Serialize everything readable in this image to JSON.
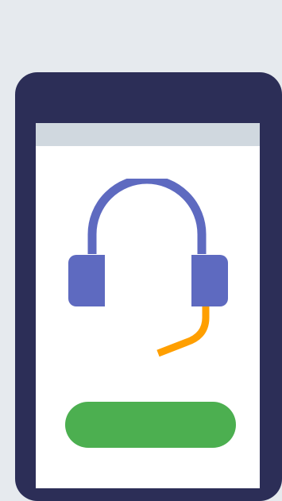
{
  "colors": {
    "background": "#e6eaee",
    "device_frame": "#2c2e57",
    "screen": "#ffffff",
    "status_bar": "#d0d8df",
    "headset": "#5e6ac0",
    "microphone": "#ff9f00",
    "button": "#4caf50"
  },
  "illustration": {
    "icon": "headset-icon"
  },
  "button": {
    "label": ""
  }
}
